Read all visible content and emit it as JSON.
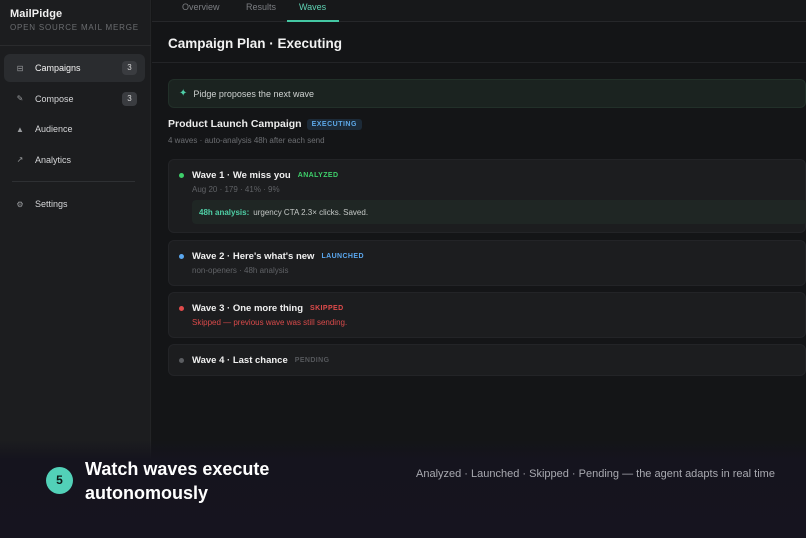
{
  "app": {
    "name": "MailPidge",
    "tagline": "OPEN SOURCE MAIL MERGE"
  },
  "sidebar": {
    "items": [
      {
        "icon": "inbox-icon",
        "label": "Campaigns",
        "badge": "3",
        "active": true
      },
      {
        "icon": "pencil-icon",
        "label": "Compose",
        "badge": "3"
      },
      {
        "icon": "person-icon",
        "label": "Audience"
      },
      {
        "icon": "trend-arrow-icon",
        "label": "Analytics"
      }
    ],
    "settings": {
      "icon": "gear-icon",
      "label": "Settings"
    }
  },
  "tabs": [
    {
      "label": "Overview"
    },
    {
      "label": "Results"
    },
    {
      "label": "Waves",
      "active": true
    }
  ],
  "header": {
    "title": "Campaign Plan · Executing"
  },
  "proposal": {
    "icon": "sparkle-icon",
    "text": "Pidge proposes the next wave"
  },
  "campaign": {
    "name": "Product Launch Campaign",
    "status": "EXECUTING",
    "meta": "4 waves · auto-analysis 48h after each send"
  },
  "waves": [
    {
      "title": "Wave 1 · We miss you",
      "status": "ANALYZED",
      "status_color": "#3ecf6a",
      "dot_color": "#3ecf6a",
      "sub": "Aug 20 · 179 · 41% · 9%",
      "analysis_label": "48h analysis:",
      "analysis_text": "urgency CTA 2.3× clicks. Saved."
    },
    {
      "title": "Wave 2 · Here's what's new",
      "status": "LAUNCHED",
      "status_color": "#5aa7ee",
      "dot_color": "#5aa7ee",
      "sub": "non-openers · 48h analysis"
    },
    {
      "title": "Wave 3 · One more thing",
      "status": "SKIPPED",
      "status_color": "#e04b4b",
      "dot_color": "#e04b4b",
      "sub": "Skipped — previous wave was still sending."
    },
    {
      "title": "Wave 4 · Last chance",
      "status": "PENDING",
      "status_color": "#55575b",
      "dot_color": "#5b5d61"
    }
  ],
  "caption": {
    "step": "5",
    "title": "Watch waves execute autonomously",
    "description": "Analyzed · Launched · Skipped · Pending — the agent adapts in real time"
  }
}
